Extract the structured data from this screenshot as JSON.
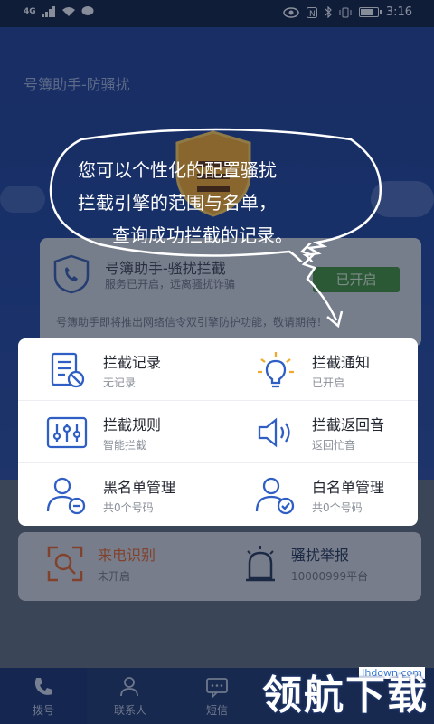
{
  "status_bar": {
    "signal": "4G",
    "time": "3:16",
    "battery_level": 0.8
  },
  "app": {
    "title": "号簿助手-防骚扰"
  },
  "bubble": {
    "line1": "您可以个性化的配置骚扰",
    "line2": "拦截引擎的范围与名单，",
    "line3": "查询成功拦截的记录。"
  },
  "status_card": {
    "title": "号簿助手-骚扰拦截",
    "subtitle": "服务已开启，远离骚扰诈骗",
    "badge": "已开启",
    "notice": "号簿助手即将推出网络信令双引擎防护功能，敬请期待！"
  },
  "features": [
    {
      "title": "拦截记录",
      "sub": "无记录",
      "icon": "record-icon"
    },
    {
      "title": "拦截通知",
      "sub": "已开启",
      "icon": "bulb-icon"
    },
    {
      "title": "拦截规则",
      "sub": "智能拦截",
      "icon": "sliders-icon"
    },
    {
      "title": "拦截返回音",
      "sub": "返回忙音",
      "icon": "speaker-icon"
    },
    {
      "title": "黑名单管理",
      "sub": "共0个号码",
      "icon": "user-minus-icon"
    },
    {
      "title": "白名单管理",
      "sub": "共0个号码",
      "icon": "user-check-icon"
    }
  ],
  "bottom": [
    {
      "title": "来电识别",
      "sub": "未开启",
      "icon": "scan-icon"
    },
    {
      "title": "骚扰举报",
      "sub": "10000999平台",
      "icon": "alarm-icon"
    }
  ],
  "tabs": [
    {
      "label": "拨号",
      "icon": "phone-icon"
    },
    {
      "label": "联系人",
      "icon": "contacts-icon"
    },
    {
      "label": "短信",
      "icon": "sms-icon"
    },
    {
      "label": "",
      "icon": ""
    },
    {
      "label": "",
      "icon": ""
    }
  ],
  "colors": {
    "header_blue": "#1e4299",
    "feature_icon_blue": "#2f5fc4",
    "bottom_orange": "#d9622a",
    "badge_green": "#3e8a3a"
  },
  "watermark": {
    "text": "领航下载",
    "url": "lhdown.com"
  }
}
